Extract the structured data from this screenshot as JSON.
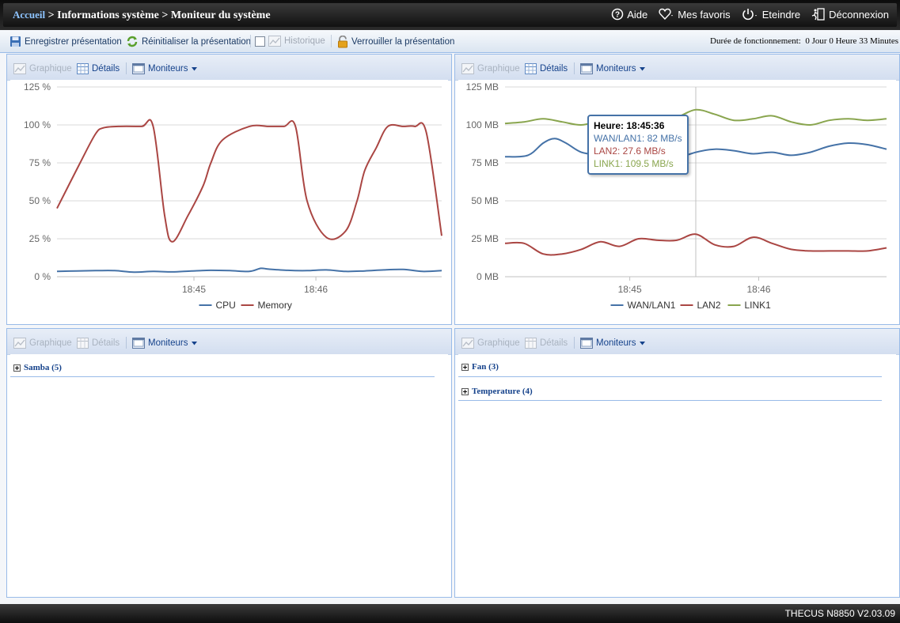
{
  "header": {
    "home": "Accueil",
    "crumb_rest": " > Informations système > Moniteur du système",
    "help": "Aide",
    "favorites": "Mes favoris",
    "shutdown": "Eteindre",
    "logout": "Déconnexion"
  },
  "toolbar": {
    "save": "Enregistrer présentation",
    "reset": "Réinitialiser la présentation",
    "history": "Historique",
    "lock": "Verrouiller la présentation",
    "uptime_label": "Durée de fonctionnement:",
    "uptime_value": "0 Jour 0 Heure 33 Minutes"
  },
  "panel_toolbar": {
    "graph": "Graphique",
    "details": "Détails",
    "monitors": "Moniteurs"
  },
  "panels": {
    "samba": "Samba (5)",
    "fan": "Fan (3)",
    "temperature": "Temperature (4)"
  },
  "footer": {
    "version": "THECUS N8850 V2.03.09"
  },
  "tooltip": {
    "time": "Heure: 18:45:36",
    "wan": "WAN/LAN1: 82 MB/s",
    "lan2": "LAN2: 27.6 MB/s",
    "link1": "LINK1: 109.5 MB/s"
  },
  "colors": {
    "blue": "#4572a7",
    "red": "#aa4643",
    "green": "#89a54e"
  },
  "chart_data": [
    {
      "type": "line",
      "ylim": [
        0,
        125
      ],
      "yticks": [
        "0 %",
        "25 %",
        "50 %",
        "75 %",
        "100 %",
        "125 %"
      ],
      "ytick_values": [
        0,
        25,
        50,
        75,
        100,
        125
      ],
      "xlim": [
        0,
        100
      ],
      "xticks": [
        {
          "label": "18:45",
          "x": 35.6
        },
        {
          "label": "18:46",
          "x": 67.3
        }
      ],
      "series": [
        {
          "name": "CPU",
          "color": "#4572a7",
          "x": [
            0,
            5,
            10,
            15,
            20,
            25,
            30,
            35,
            40,
            45,
            50,
            53,
            55,
            60,
            65,
            70,
            75,
            80,
            85,
            90,
            95,
            100
          ],
          "y": [
            3.5,
            3.8,
            4,
            4,
            3,
            3.5,
            3.2,
            3.8,
            4.2,
            4,
            3.5,
            5.5,
            5,
            4.2,
            4,
            4.5,
            3.5,
            3.8,
            4.5,
            4.8,
            3.5,
            4
          ]
        },
        {
          "name": "Memory",
          "color": "#aa4643",
          "x": [
            0,
            6,
            10,
            12,
            16,
            22,
            25,
            28,
            30,
            34,
            38,
            40,
            43,
            50,
            55,
            59,
            62,
            65,
            70,
            75,
            78,
            80,
            83,
            86,
            90,
            93,
            96,
            100
          ],
          "y": [
            45,
            75,
            94,
            98,
            99,
            99,
            99,
            40,
            23,
            40,
            60,
            75,
            90,
            99,
            99,
            99,
            99,
            50,
            26,
            30,
            50,
            70,
            85,
            99,
            99,
            99,
            95,
            27
          ]
        }
      ]
    },
    {
      "type": "line",
      "ylim": [
        0,
        125
      ],
      "yticks": [
        "0 MB",
        "25 MB",
        "50 MB",
        "75 MB",
        "100 MB",
        "125 MB"
      ],
      "ytick_values": [
        0,
        25,
        50,
        75,
        100,
        125
      ],
      "xlim": [
        0,
        100
      ],
      "xticks": [
        {
          "label": "18:45",
          "x": 32.7
        },
        {
          "label": "18:46",
          "x": 66.5
        }
      ],
      "series": [
        {
          "name": "WAN/LAN1",
          "color": "#4572a7",
          "x": [
            0,
            6,
            10,
            13,
            16,
            20,
            25,
            30,
            35,
            40,
            45,
            50,
            55,
            60,
            65,
            70,
            75,
            80,
            85,
            90,
            95,
            100
          ],
          "y": [
            79,
            80,
            88,
            91,
            88,
            82,
            80,
            79,
            78,
            77,
            78,
            82,
            84,
            83,
            81,
            82,
            80,
            82,
            86,
            88,
            87,
            84
          ]
        },
        {
          "name": "LAN2",
          "color": "#aa4643",
          "x": [
            0,
            5,
            10,
            15,
            20,
            25,
            30,
            35,
            40,
            45,
            50,
            55,
            60,
            65,
            70,
            75,
            80,
            85,
            90,
            95,
            100
          ],
          "y": [
            22,
            22,
            15,
            15,
            18,
            23,
            20,
            25,
            24,
            24,
            28,
            21,
            20,
            26,
            22,
            18,
            17,
            17,
            17,
            17,
            19
          ]
        },
        {
          "name": "LINK1",
          "color": "#89a54e",
          "x": [
            0,
            5,
            10,
            15,
            20,
            25,
            30,
            35,
            40,
            45,
            50,
            55,
            60,
            65,
            70,
            75,
            80,
            85,
            90,
            95,
            100
          ],
          "y": [
            101,
            102,
            104,
            102,
            100,
            103,
            106,
            104,
            103,
            105,
            110,
            107,
            103,
            104,
            106,
            102,
            100,
            103,
            104,
            103,
            104
          ]
        }
      ]
    }
  ]
}
